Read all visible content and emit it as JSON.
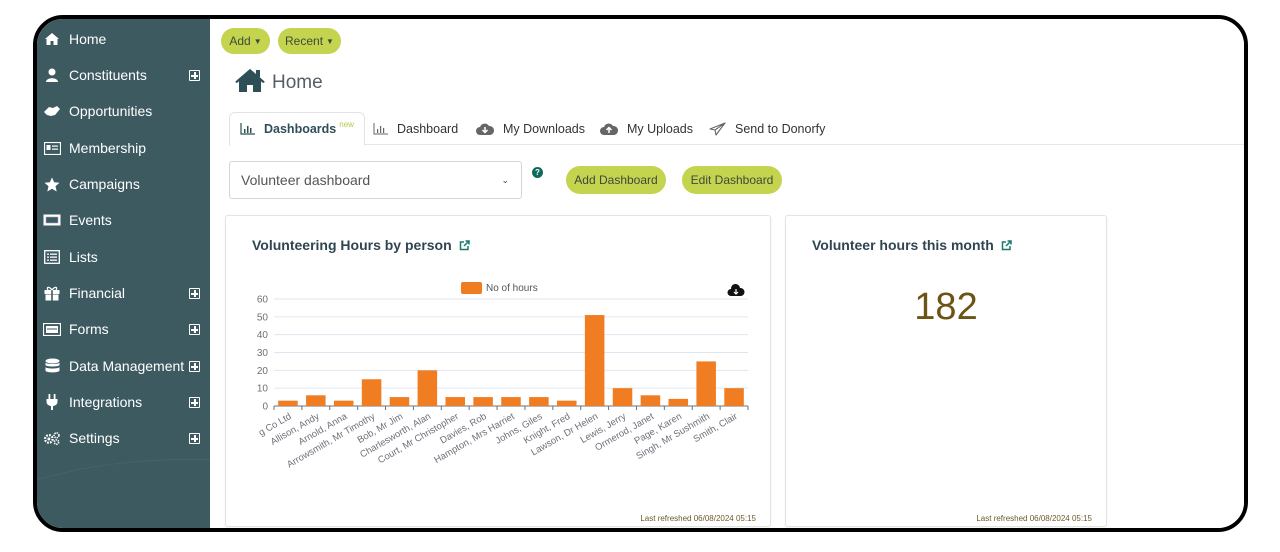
{
  "sidebar": {
    "items": [
      {
        "label": "Home",
        "icon": "home-icon",
        "expandable": false
      },
      {
        "label": "Constituents",
        "icon": "user-icon",
        "expandable": true
      },
      {
        "label": "Opportunities",
        "icon": "handshake-icon",
        "expandable": false
      },
      {
        "label": "Membership",
        "icon": "id-card-icon",
        "expandable": false
      },
      {
        "label": "Campaigns",
        "icon": "star-icon",
        "expandable": false
      },
      {
        "label": "Events",
        "icon": "ticket-icon",
        "expandable": false
      },
      {
        "label": "Lists",
        "icon": "list-icon",
        "expandable": false
      },
      {
        "label": "Financial",
        "icon": "gift-icon",
        "expandable": true
      },
      {
        "label": "Forms",
        "icon": "form-icon",
        "expandable": true
      },
      {
        "label": "Data Management",
        "icon": "database-icon",
        "expandable": true
      },
      {
        "label": "Integrations",
        "icon": "plug-icon",
        "expandable": true
      },
      {
        "label": "Settings",
        "icon": "cogs-icon",
        "expandable": true
      }
    ]
  },
  "topbar": {
    "add_label": "Add",
    "recent_label": "Recent"
  },
  "page": {
    "title": "Home"
  },
  "tabs": [
    {
      "label": "Dashboards",
      "badge": "new",
      "icon": "bar-chart-icon",
      "active": true
    },
    {
      "label": "Dashboard",
      "icon": "bar-chart-icon",
      "active": false
    },
    {
      "label": "My Downloads",
      "icon": "cloud-download-icon",
      "active": false
    },
    {
      "label": "My Uploads",
      "icon": "cloud-upload-icon",
      "active": false
    },
    {
      "label": "Send to Donorfy",
      "icon": "paper-plane-icon",
      "active": false
    }
  ],
  "dashboard_select": {
    "value": "Volunteer dashboard"
  },
  "buttons": {
    "add_dashboard": "Add Dashboard",
    "edit_dashboard": "Edit Dashboard"
  },
  "widgets": {
    "hours_by_person": {
      "title": "Volunteering Hours by person",
      "last_refreshed": "Last refreshed 06/08/2024 05:15"
    },
    "hours_this_month": {
      "title": "Volunteer hours this month",
      "value": "182",
      "last_refreshed": "Last refreshed 06/08/2024 05:15"
    }
  },
  "colors": {
    "sidebar_bg": "#3d5a61",
    "accent_pill": "#c4d44e",
    "bar": "#f07d22",
    "kpi_value": "#6b5414"
  },
  "chart_data": {
    "type": "bar",
    "title": "Volunteering Hours by person",
    "legend": [
      "No of hours"
    ],
    "legend_position": "top-center",
    "xlabel": "",
    "ylabel": "",
    "ylim": [
      0,
      60
    ],
    "yticks": [
      0,
      10,
      20,
      30,
      40,
      50,
      60
    ],
    "grid": true,
    "categories": [
      "g Co Ltd",
      "Allison, Andy",
      "Arnold, Anna",
      "Arrowsmith, Mr Timothy",
      "Bob, Mr Jim",
      "Charlesworth, Alan",
      "Court, Mr Christopher",
      "Davies, Rob",
      "Hampton, Mrs Harriet",
      "Johns, Giles",
      "Knight, Fred",
      "Lawson, Dr Helen",
      "Lewis, Jerry",
      "Ormerod, Janet",
      "Page, Karen",
      "Singh, Mr Sushmith",
      "Smith, Clair"
    ],
    "series": [
      {
        "name": "No of hours",
        "values": [
          3,
          6,
          3,
          15,
          5,
          20,
          5,
          5,
          5,
          5,
          3,
          51,
          10,
          6,
          4,
          25,
          10
        ]
      }
    ]
  }
}
